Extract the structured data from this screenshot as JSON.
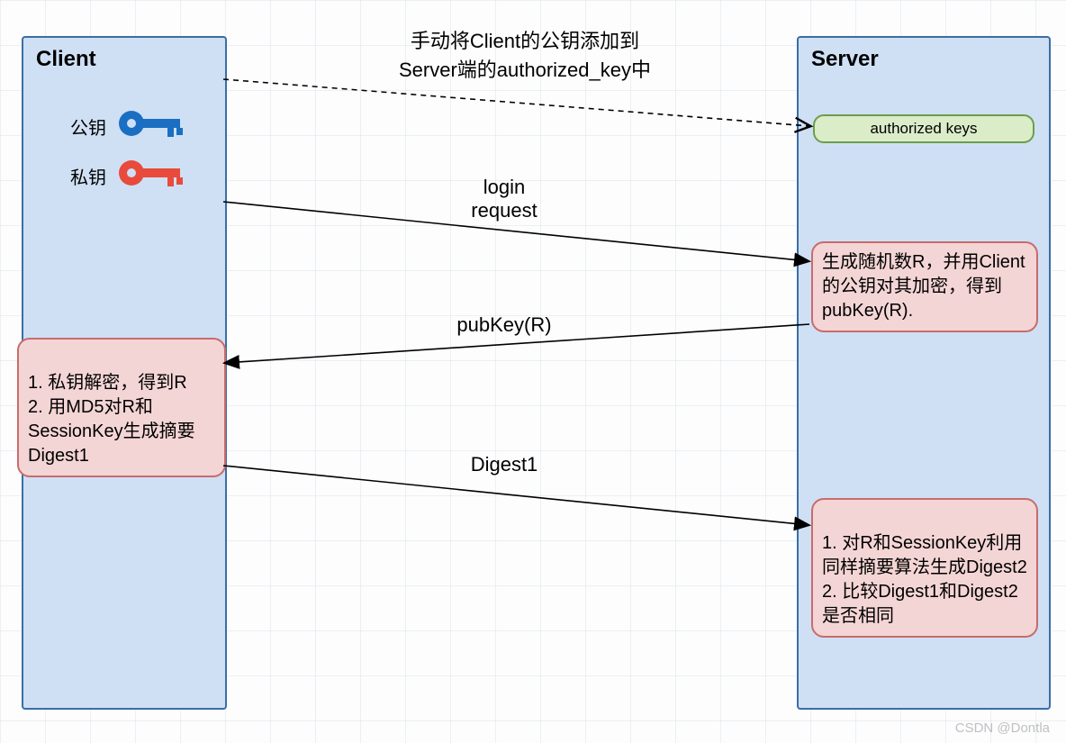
{
  "client": {
    "title": "Client",
    "publicKeyLabel": "公钥",
    "privateKeyLabel": "私钥"
  },
  "server": {
    "title": "Server",
    "authorizedKeys": "authorized keys"
  },
  "annotations": {
    "manualAdd": "手动将Client的公钥添加到\nServer端的authorized_key中",
    "loginRequest": "login\nrequest",
    "pubkeyR": "pubKey(R)",
    "digest1": "Digest1"
  },
  "steps": {
    "serverGenR": "生成随机数R，并用Client的公钥对其加密，得到pubKey(R).",
    "clientDecrypt": "1. 私钥解密，得到R\n2. 用MD5对R和SessionKey生成摘要Digest1",
    "serverVerify": "1. 对R和SessionKey利用同样摘要算法生成Digest2\n2. 比较Digest1和Digest2是否相同"
  },
  "watermark": "CSDN @Dontla",
  "icons": {
    "publicKeyColor": "#1b6fc2",
    "privateKeyColor": "#e84b3c"
  }
}
